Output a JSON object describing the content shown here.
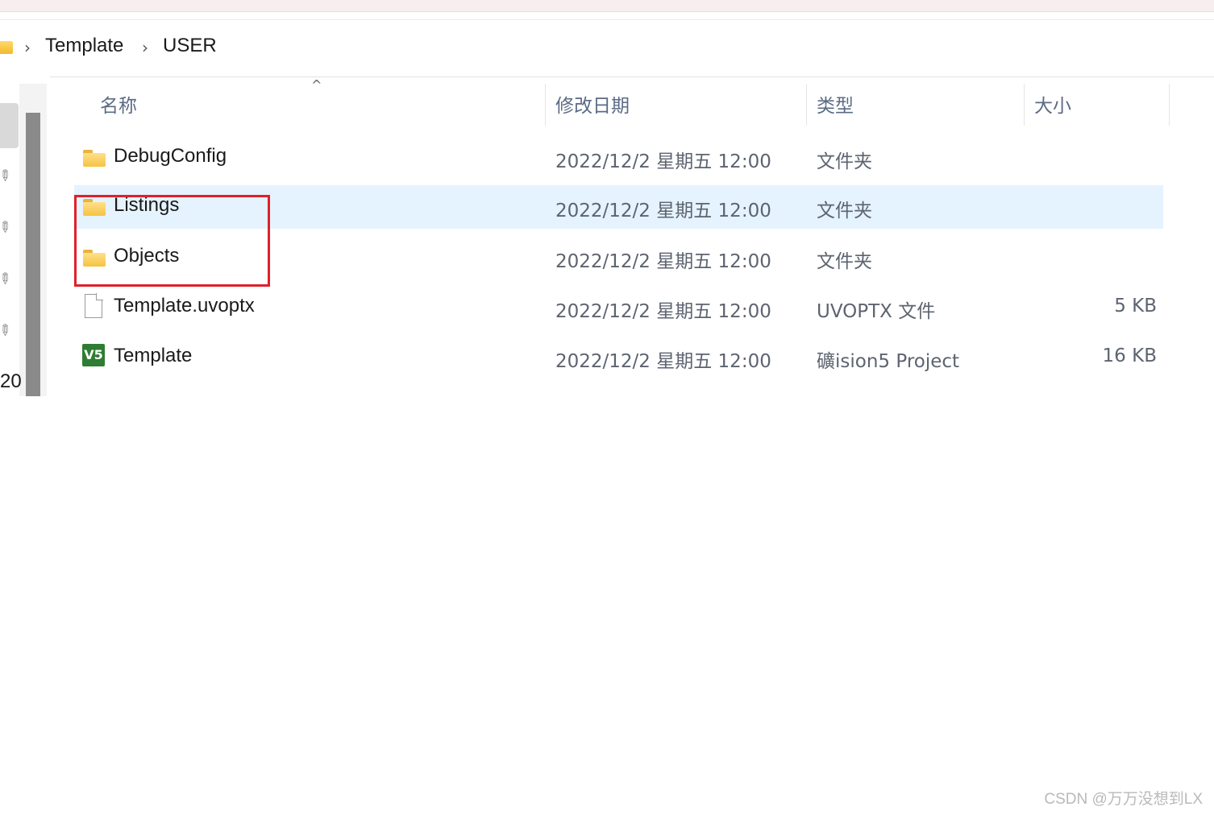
{
  "breadcrumb": {
    "separator": "›",
    "items": [
      "Template",
      "USER"
    ]
  },
  "nav": {
    "partial_text": "20"
  },
  "columns": {
    "name": "名称",
    "date": "修改日期",
    "type": "类型",
    "size": "大小",
    "sort_indicator": "^"
  },
  "files": [
    {
      "name": "DebugConfig",
      "date": "2022/12/2 星期五 12:00",
      "type": "文件夹",
      "size": "",
      "icon": "folder-icon"
    },
    {
      "name": "Listings",
      "date": "2022/12/2 星期五 12:00",
      "type": "文件夹",
      "size": "",
      "icon": "folder-icon"
    },
    {
      "name": "Objects",
      "date": "2022/12/2 星期五 12:00",
      "type": "文件夹",
      "size": "",
      "icon": "folder-icon"
    },
    {
      "name": "Template.uvoptx",
      "date": "2022/12/2 星期五 12:00",
      "type": "UVOPTX 文件",
      "size": "5 KB",
      "icon": "file-icon"
    },
    {
      "name": "Template",
      "date": "2022/12/2 星期五 12:00",
      "type": "礦ision5 Project",
      "size": "16 KB",
      "icon": "uvision-project-icon",
      "icon_text": "V5"
    }
  ],
  "colors": {
    "selected_row": "#e5f3ff",
    "highlight_box": "#e0202a"
  },
  "watermark": "CSDN @万万没想到LX"
}
